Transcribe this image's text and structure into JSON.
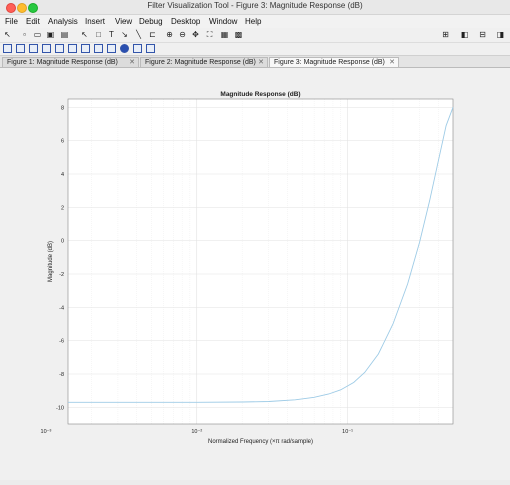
{
  "window": {
    "title": "Filter Visualization Tool - Figure 3: Magnitude Response (dB)"
  },
  "menu": [
    "File",
    "Edit",
    "Analysis",
    "Insert",
    "View",
    "Debug",
    "Desktop",
    "Window",
    "Help"
  ],
  "toolbar": {
    "icons": [
      "arrow-icon",
      "new-figure-icon",
      "open-icon",
      "save-icon",
      "print-icon",
      "select-icon",
      "rectangle-icon",
      "text-icon",
      "arrow-annotation-icon",
      "line-icon",
      "legend-icon",
      "zoom-in-icon",
      "zoom-out-icon",
      "pan-icon",
      "fit-icon",
      "colorbar-icon",
      "grid-icon"
    ],
    "layout_icons": [
      "tile-icon",
      "layout-left-icon",
      "layout-split-icon",
      "layout-right-icon"
    ],
    "analysis_icons": [
      "magnitude-icon",
      "phase-icon",
      "mag-phase-icon",
      "group-delay-icon",
      "phase-delay-icon",
      "impulse-icon",
      "step-icon",
      "pole-zero-icon",
      "coefficients-icon",
      "info-icon",
      "filter-spec-icon",
      "cost-icon"
    ]
  },
  "tabs": [
    {
      "label": "Figure 1: Magnitude Response (dB)"
    },
    {
      "label": "Figure 2: Magnitude Response (dB)"
    },
    {
      "label": "Figure 3: Magnitude Response (dB)"
    }
  ],
  "tab_close": "✕",
  "chart_data": {
    "type": "line",
    "title": "Magnitude Response (dB)",
    "xlabel": "Normalized Frequency (×π rad/sample)",
    "ylabel": "Magnitude (dB)",
    "xscale": "log",
    "xlim": [
      0.0014,
      0.5
    ],
    "ylim": [
      -11,
      8.5
    ],
    "yticks": [
      -10,
      -8,
      -6,
      -4,
      -2,
      0,
      2,
      4,
      6,
      8
    ],
    "xticks": [
      0.001,
      0.01,
      0.1
    ],
    "xtick_labels": [
      "10⁻³",
      "10⁻²",
      "10⁻¹"
    ],
    "grid": true,
    "series": [
      {
        "color": "#9ecbe6",
        "x": [
          0.0014,
          0.003,
          0.006,
          0.01,
          0.02,
          0.03,
          0.045,
          0.06,
          0.075,
          0.09,
          0.11,
          0.13,
          0.16,
          0.2,
          0.25,
          0.3,
          0.35,
          0.4,
          0.45,
          0.5
        ],
        "y": [
          -9.7,
          -9.7,
          -9.7,
          -9.7,
          -9.68,
          -9.65,
          -9.55,
          -9.4,
          -9.2,
          -8.95,
          -8.5,
          -7.9,
          -6.8,
          -5.0,
          -2.6,
          -0.1,
          2.4,
          4.8,
          6.9,
          8.0
        ]
      }
    ]
  }
}
